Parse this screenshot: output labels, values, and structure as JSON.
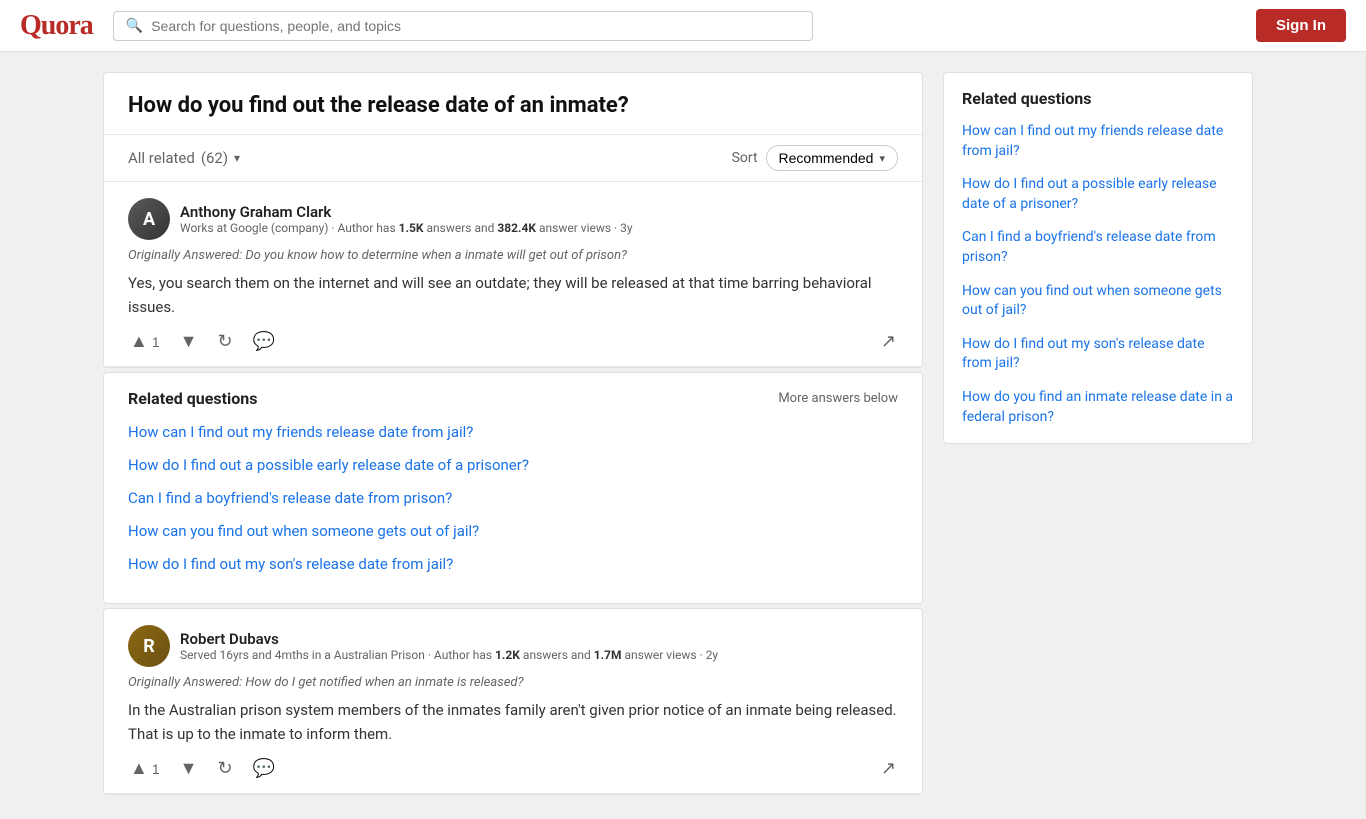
{
  "header": {
    "logo": "Quora",
    "search_placeholder": "Search for questions, people, and topics",
    "signin_label": "Sign In"
  },
  "question": {
    "title": "How do you find out the release date of an inmate?"
  },
  "toolbar": {
    "all_related": "All related",
    "count": "(62)",
    "sort_label": "Sort",
    "recommended_label": "Recommended"
  },
  "answers": [
    {
      "id": "agc",
      "author_name": "Anthony Graham Clark",
      "author_meta_prefix": "Works at Google (company) · Author has ",
      "answers_count": "1.5K",
      "answers_suffix": " answers and ",
      "views_count": "382.4K",
      "views_suffix": " answer views · 3y",
      "originally_answered": "Originally Answered: Do you know how to determine when a inmate will get out of prison?",
      "answer_text": "Yes, you search them on the internet and will see an outdate; they will be released at that time barring behavioral issues.",
      "upvotes": "1",
      "avatar_initials": "A"
    },
    {
      "id": "rd",
      "author_name": "Robert Dubavs",
      "author_meta_prefix": "Served 16yrs and 4mths in a Australian Prison · Author has ",
      "answers_count": "1.2K",
      "answers_suffix": " answers and ",
      "views_count": "1.7M",
      "views_suffix": " answer views · 2y",
      "originally_answered": "Originally Answered: How do I get notified when an inmate is released?",
      "answer_text": "In the Australian prison system members of the inmates family aren't given prior notice of an inmate being released. That is up to the inmate to inform them.",
      "upvotes": "1",
      "avatar_initials": "R"
    }
  ],
  "related_inline": {
    "title": "Related questions",
    "more_label": "More answers below",
    "links": [
      "How can I find out my friends release date from jail?",
      "How do I find out a possible early release date of a prisoner?",
      "Can I find a boyfriend's release date from prison?",
      "How can you find out when someone gets out of jail?",
      "How do I find out my son's release date from jail?"
    ]
  },
  "sidebar": {
    "title": "Related questions",
    "links": [
      "How can I find out my friends release date from jail?",
      "How do I find out a possible early release date of a prisoner?",
      "Can I find a boyfriend's release date from prison?",
      "How can you find out when someone gets out of jail?",
      "How do I find out my son's release date from jail?",
      "How do you find an inmate release date in a federal prison?"
    ]
  }
}
